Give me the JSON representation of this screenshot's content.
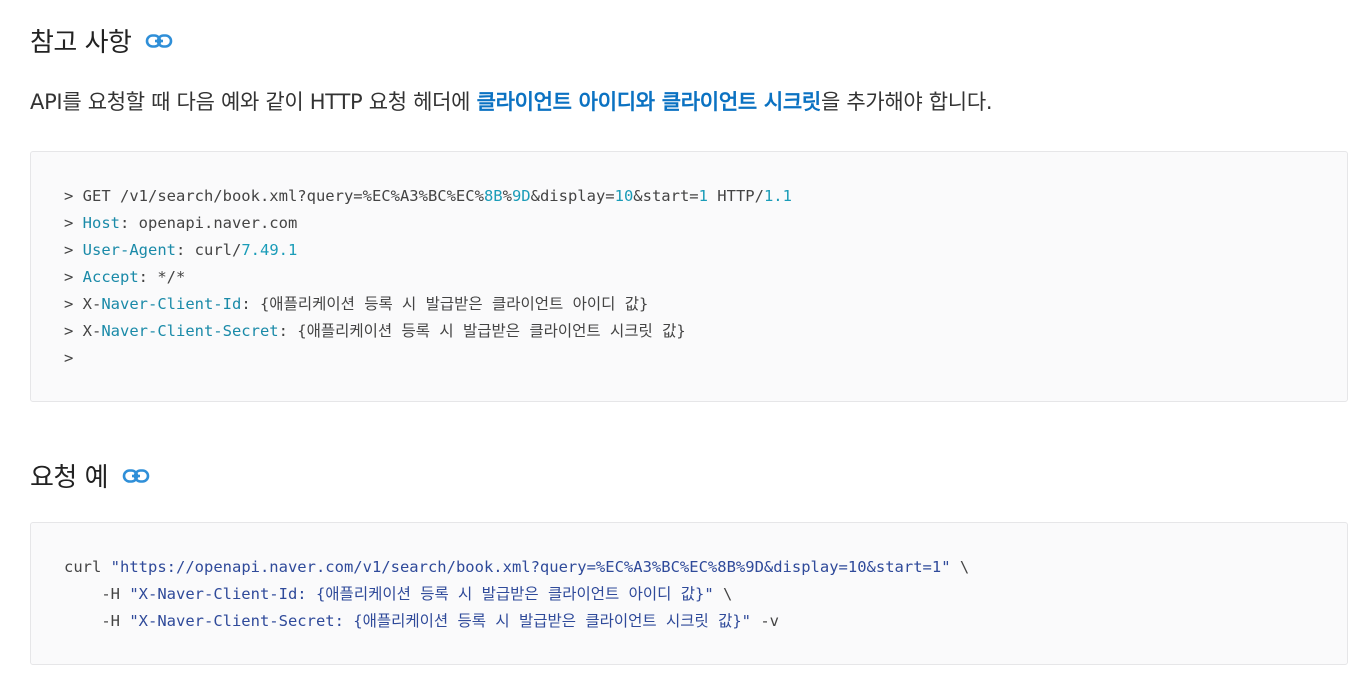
{
  "sections": {
    "reference": {
      "title": "참고 사항",
      "link_icon": "link-icon",
      "intro_before": "API를 요청할 때 다음 예와 같이 HTTP 요청 헤더에 ",
      "intro_highlight": "클라이언트 아이디와 클라이언트 시크릿",
      "intro_after": "을 추가해야 합니다."
    },
    "request_example": {
      "title": "요청 예",
      "link_icon": "link-icon"
    }
  },
  "headers_block": {
    "line1": {
      "prefix": "> GET /v1/search/book.xml?query=%EC%A3%BC%EC%",
      "n1": "8B",
      "mid1": "%",
      "n2": "9D",
      "mid2": "&display=",
      "n3": "10",
      "mid3": "&start=",
      "n4": "1",
      "mid4": " HTTP/",
      "n5": "1.1"
    },
    "line2": {
      "prefix": "> ",
      "name": "Host",
      "value": ": openapi.naver.com"
    },
    "line3": {
      "prefix": "> ",
      "name": "User-Agent",
      "sep": ": curl/",
      "version": "7.49.1"
    },
    "line4": {
      "prefix": "> ",
      "name": "Accept",
      "value": ": */*"
    },
    "line5": {
      "prefix": "> X-",
      "name": "Naver-Client-Id",
      "value": ": {애플리케이션 등록 시 발급받은 클라이언트 아이디 값}"
    },
    "line6": {
      "prefix": "> X-",
      "name": "Naver-Client-Secret",
      "value": ": {애플리케이션 등록 시 발급받은 클라이언트 시크릿 값}"
    },
    "line7": ">"
  },
  "curl_block": {
    "line1": {
      "cmd": "curl ",
      "url": "\"https://openapi.naver.com/v1/search/book.xml?query=%EC%A3%BC%EC%8B%9D&display=10&start=1\"",
      "tail": " \\"
    },
    "line2": {
      "indent": "    -H ",
      "header": "\"X-Naver-Client-Id: {애플리케이션 등록 시 발급받은 클라이언트 아이디 값}\"",
      "tail": " \\"
    },
    "line3": {
      "indent": "    -H ",
      "header": "\"X-Naver-Client-Secret: {애플리케이션 등록 시 발급받은 클라이언트 시크릿 값}\"",
      "tail": " -v"
    }
  },
  "colors": {
    "highlight": "#0b72c2",
    "header_name": "#1a8aa8",
    "number": "#1a9cb8",
    "string": "#2f4a9a",
    "link_icon": "#2f8fd8"
  }
}
